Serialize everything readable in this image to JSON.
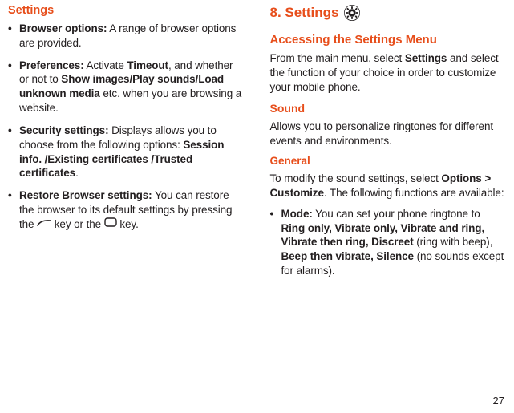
{
  "left": {
    "heading": "Settings",
    "items": [
      {
        "boldLead": "Browser options:",
        "rest": " A range of browser options are provided."
      },
      {
        "boldLead": "Preferences:",
        "mid1": " Activate ",
        "b1": "Timeout",
        "mid2": ", and whether or not to ",
        "b2": "Show images/Play sounds/Load unknown media",
        "tail": " etc. when you are browsing a website."
      },
      {
        "boldLead": "Security settings:",
        "mid1": " Displays allows you to choose from the following options: ",
        "b1": "Session info. /Existing certificates /Trusted certificates",
        "tail": "."
      },
      {
        "boldLead": "Restore Browser settings:",
        "mid1": " You can restore the browser to its default settings by pressing the ",
        "keyA": "send-key",
        "mid2": " key or the ",
        "keyB": "softkey",
        "tail": " key."
      }
    ]
  },
  "right": {
    "chapter": "8.  Settings",
    "icon": "gear-icon",
    "access": {
      "heading": "Accessing the Settings Menu",
      "p_a": "From the main menu, select ",
      "p_b": "Settings",
      "p_c": " and select the function of your choice in order to customize your mobile phone."
    },
    "sound": {
      "heading": "Sound",
      "p": "Allows you to personalize ringtones for different events and environments."
    },
    "general": {
      "heading": "General",
      "intro_a": "To modify the sound settings, select ",
      "intro_b": "Options > Customize",
      "intro_c": ". The following functions are available:",
      "item": {
        "boldLead": "Mode:",
        "mid1": " You can set your phone ringtone to ",
        "b1": "Ring only,  Vibrate only, Vibrate and ring, Vibrate then ring, Discreet",
        "mid2": " (ring with beep),  ",
        "b2": "Beep then vibrate, Silence",
        "tail": " (no sounds except for alarms)."
      }
    }
  },
  "pageNumber": "27"
}
